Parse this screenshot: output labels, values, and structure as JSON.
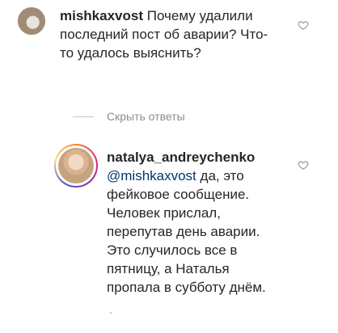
{
  "comments": [
    {
      "username": "mishkaxvost",
      "lines": [
        "Почему удалили",
        "последний пост об аварии? Что-",
        "то удалось выяснить?"
      ]
    }
  ],
  "hide_replies_label": "Скрыть ответы",
  "reply": {
    "username": "natalya_andreychenko",
    "mention": "@mishkaxvost",
    "first_line_rest": " да, это",
    "lines": [
      "фейковое сообщение.",
      "Человек прислал,",
      "перепутав день аварии.",
      "Это случилось все в",
      "пятницу, а Наталья",
      "пропала в субботу днём."
    ]
  },
  "icons": {
    "like": "heart-outline-icon"
  },
  "colors": {
    "username": "#262626",
    "mention": "#00376b",
    "muted": "#8e8e8e"
  }
}
